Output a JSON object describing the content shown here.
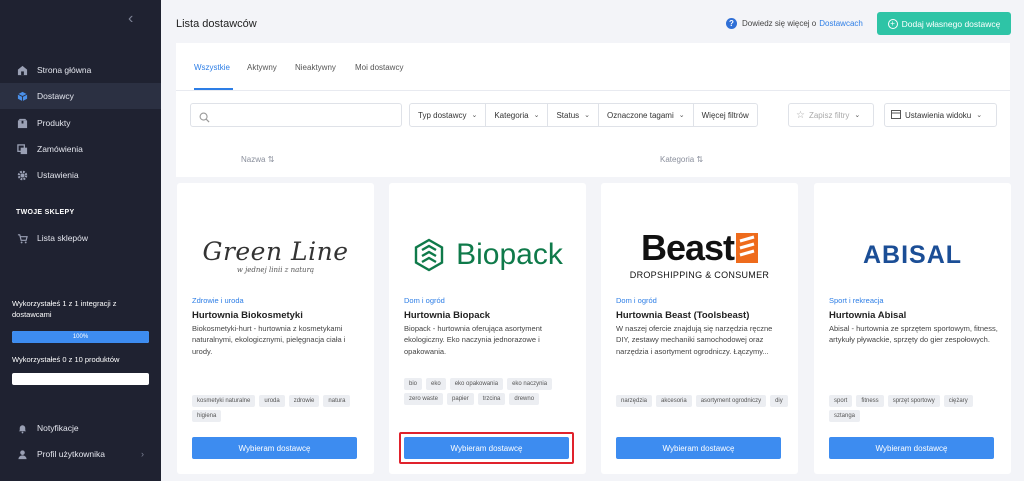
{
  "sidebar": {
    "items": [
      {
        "label": "Strona główna",
        "icon": "home-icon"
      },
      {
        "label": "Dostawcy",
        "icon": "box-icon"
      },
      {
        "label": "Produkty",
        "icon": "package-icon"
      },
      {
        "label": "Zamówienia",
        "icon": "orders-icon"
      },
      {
        "label": "Ustawienia",
        "icon": "gear-icon"
      }
    ],
    "section_title": "TWOJE SKLEPY",
    "shops_label": "Lista sklepów",
    "integration_usage": "Wykorzystałeś 1 z 1 integracji z dostawcami",
    "integration_percent_label": "100%",
    "integration_progress": 1.0,
    "product_usage": "Wykorzystałeś 0 z 10 produktów",
    "product_progress": 0.0,
    "notifications_label": "Notyfikacje",
    "profile_label": "Profil użytkownika"
  },
  "header": {
    "title": "Lista dostawców",
    "help_text": "Dowiedz się więcej o",
    "help_link": "Dostawcach",
    "add_button": "Dodaj własnego dostawcę"
  },
  "tabs": [
    "Wszystkie",
    "Aktywny",
    "Nieaktywny",
    "Moi dostawcy"
  ],
  "filters": {
    "search_placeholder": "",
    "items": [
      "Typ dostawcy",
      "Kategoria",
      "Status",
      "Oznaczone tagami",
      "Więcej filtrów"
    ],
    "save_filters": "Zapisz filtry",
    "view_settings": "Ustawienia widoku"
  },
  "columns": {
    "name": "Nazwa",
    "category": "Kategoria"
  },
  "cards": [
    {
      "logo_text": "Green Line",
      "logo_tagline": "w jednej linii z naturą",
      "category": "Zdrowie i uroda",
      "name": "Hurtownia Biokosmetyki",
      "description": "Biokosmetyki-hurt - hurtownia z kosmetykami naturalnymi, ekologicznymi, pielęgnacja ciała i urody.",
      "tags": [
        "kosmetyki naturalne",
        "uroda",
        "zdrowie",
        "natura",
        "higiena"
      ],
      "button": "Wybieram dostawcę"
    },
    {
      "logo_text": "Biopack",
      "category": "Dom i ogród",
      "name": "Hurtownia Biopack",
      "description": "Biopack - hurtownia oferująca asortyment ekologiczny. Eko naczynia jednorazowe i opakowania.",
      "tags": [
        "bio",
        "eko",
        "eko opakowania",
        "eko naczynia",
        "zero waste",
        "papier",
        "trzcina",
        "drewno"
      ],
      "button": "Wybieram dostawcę"
    },
    {
      "logo_text": "Beast",
      "logo_tagline": "DROPSHIPPING & CONSUMER",
      "category": "Dom i ogród",
      "name": "Hurtownia Beast (Toolsbeast)",
      "description": "W naszej ofercie znajdują się narzędzia ręczne DIY, zestawy mechaniki samochodowej oraz narzędzia i asortyment ogrodniczy. Łączymy...",
      "tags": [
        "narzędzia",
        "akcesoria",
        "asortyment ogrodniczy",
        "diy"
      ],
      "button": "Wybieram dostawcę"
    },
    {
      "logo_text": "ABISAL",
      "category": "Sport i rekreacja",
      "name": "Hurtownia Abisal",
      "description": "Abisal - hurtownia ze sprzętem sportowym, fitness, artykuły pływackie, sprzęty do gier zespołowych.",
      "tags": [
        "sport",
        "fitness",
        "sprzęt sportowy",
        "ciężary",
        "sztanga"
      ],
      "button": "Wybieram dostawcę"
    }
  ],
  "colors": {
    "accent": "#3d8cf0",
    "add_button": "#2ec4a6",
    "sidebar": "#1f2231",
    "highlight": "#e0222c"
  }
}
